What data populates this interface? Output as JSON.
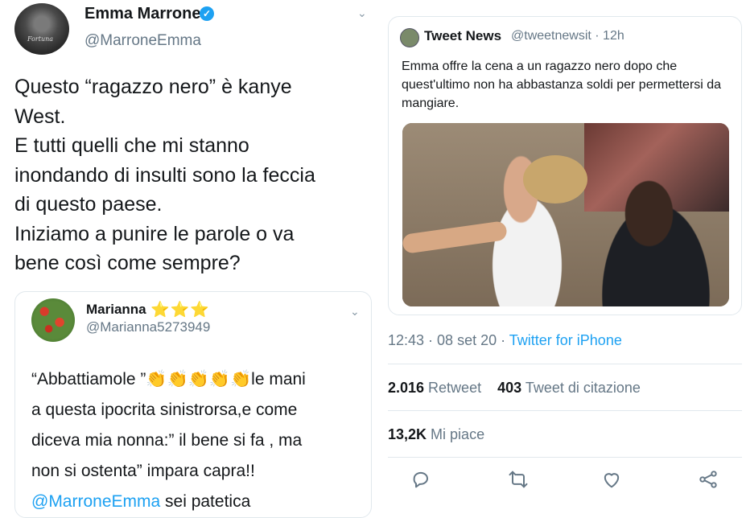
{
  "left": {
    "author": {
      "name": "Emma Marrone",
      "handle": "@MarroneEmma",
      "avatar_sig": "Fortuna"
    },
    "text_lines": [
      "Questo “ragazzo nero” è kanye",
      "West.",
      "E tutti quelli che mi stanno",
      "inondando di insulti sono la feccia",
      "di questo paese.",
      "Iniziamo a punire le parole o va",
      "bene così come sempre?"
    ],
    "quote": {
      "name": "Marianna",
      "stars": "⭐⭐⭐",
      "handle": "@Marianna5273949",
      "line1_a": "“Abbattiamole ”",
      "line1_claps": "👏👏👏👏👏",
      "line1_b": "le mani",
      "line2": "a questa ipocrita sinistrorsa,e come",
      "line3": "diceva mia nonna:” il bene si fa , ma",
      "line4": "non si ostenta” impara capra!!",
      "line5_mention": "@MarroneEmma",
      "line5_rest": " sei patetica"
    }
  },
  "right": {
    "quote": {
      "name": "Tweet News",
      "handle": "@tweetnewsit · 12h",
      "text": "Emma offre la cena a un ragazzo nero dopo che quest'ultimo non ha abbastanza soldi per permettersi da mangiare."
    },
    "meta": {
      "time": "12:43 · 08 set 20 · ",
      "source": "Twitter for iPhone"
    },
    "stats": {
      "retweets": "2.016",
      "retweets_label": " Retweet",
      "quotes": "403",
      "quotes_label": " Tweet di citazione",
      "likes": "13,2K",
      "likes_label": " Mi piace"
    }
  },
  "colors": {
    "accent": "#1da1f2",
    "secondary_text": "#657786",
    "border": "#e1e8ed"
  }
}
